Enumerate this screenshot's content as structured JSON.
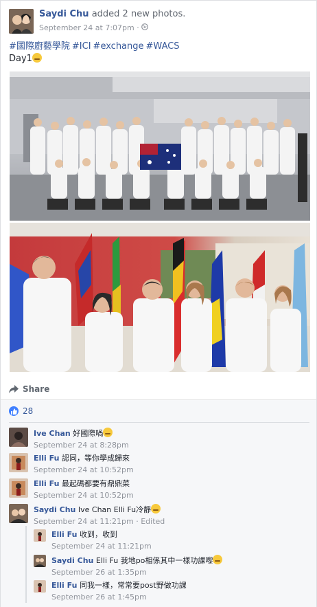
{
  "post": {
    "author": "Saydi Chu",
    "action": " added 2 new photos.",
    "time": "September 24 at 7:07pm",
    "separator": "·",
    "audience_icon": "globe-icon",
    "hashtags": [
      "#國際廚藝學院",
      "#ICI",
      "#exchange",
      "#WACS"
    ],
    "line2": "Day1"
  },
  "actions": {
    "share_label": "Share"
  },
  "reactions": {
    "count": "28"
  },
  "comments": [
    {
      "name": "Ive Chan",
      "text": "好國際喎",
      "emoji": true,
      "meta": "September 24 at 8:28pm"
    },
    {
      "name": "Elli Fu",
      "text": "認同，等你學成歸來",
      "meta": "September 24 at 10:52pm"
    },
    {
      "name": "Elli Fu",
      "text": "最起碼都要有鼎鼎菜",
      "meta": "September 24 at 10:52pm"
    },
    {
      "name": "Saydi Chu",
      "text": "Ive Chan Elli Fu冷靜",
      "emoji": true,
      "meta": "September 24 at 11:21pm · Edited"
    }
  ],
  "replies": [
    {
      "name": "Elli Fu",
      "text": "收到，收到",
      "meta": "September 24 at 11:21pm"
    },
    {
      "name": "Saydi Chu",
      "text": "Elli Fu 我地po相係其中一樣功課嚟",
      "emoji": true,
      "meta": "September 26 at 1:35pm"
    },
    {
      "name": "Elli Fu",
      "text": "同我一樣，常常要post野做功課",
      "meta": "September 26 at 1:45pm"
    }
  ]
}
